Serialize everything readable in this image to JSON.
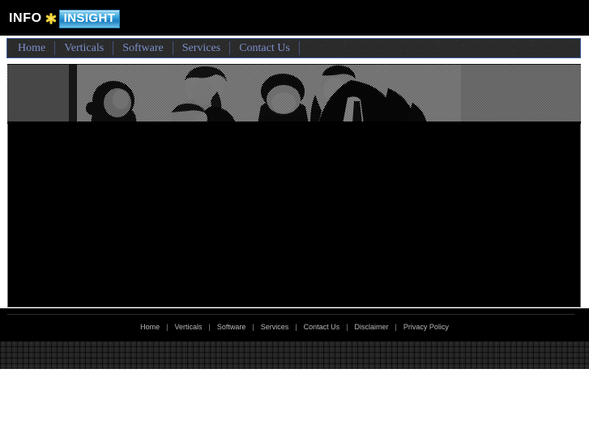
{
  "site": {
    "logo": {
      "text_primary": "INFO",
      "icon": "star-asterisk-icon",
      "text_secondary": "INSIGHT",
      "primary_color": "#ffffff",
      "star_color": "#f2d43a",
      "badge_color": "#1b7fc0"
    }
  },
  "nav": {
    "items": [
      {
        "label": "Home"
      },
      {
        "label": "Verticals"
      },
      {
        "label": "Software"
      },
      {
        "label": "Services"
      },
      {
        "label": "Contact Us"
      }
    ],
    "separator": "|",
    "link_color": "#7d8fcb",
    "border_color": "#3d5a9e",
    "background_color": "#2b2b2b"
  },
  "banner": {
    "alt": "halftone black and white photo of five business people in a meeting",
    "style": "halftone-dither-grayscale"
  },
  "content": {
    "background_color": "#000000",
    "border_color": "#6a6a6a",
    "body_text": ""
  },
  "footer": {
    "links": [
      {
        "label": "Home"
      },
      {
        "label": "Verticals"
      },
      {
        "label": "Software"
      },
      {
        "label": "Services"
      },
      {
        "label": "Contact Us"
      },
      {
        "label": "Disclaimer"
      },
      {
        "label": "Privacy Policy"
      }
    ],
    "separator": "|",
    "link_color": "#b9b9b9"
  }
}
